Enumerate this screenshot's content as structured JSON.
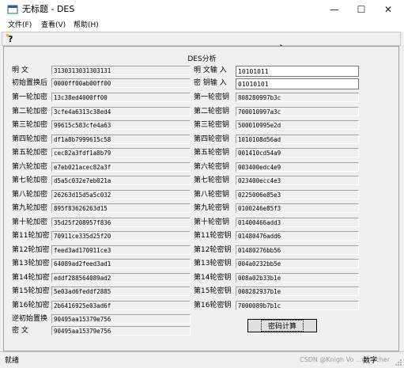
{
  "window": {
    "title": "无标题 - DES"
  },
  "menu": [
    "文件(F)",
    "查看(V)",
    "帮助(H)"
  ],
  "dialog_title": "DES分析",
  "plaintext": {
    "label": "明  文",
    "value": "3130313031303131"
  },
  "initial_perm": {
    "label": "初始置换后",
    "value": "0000ff00ab00ff00"
  },
  "left_rows": [
    {
      "label": "第一轮加密",
      "value": "13c38ed4000ff00"
    },
    {
      "label": "第二轮加密",
      "value": "3cfe4a6313c38ed4"
    },
    {
      "label": "第三轮加密",
      "value": "99615c583cfe4a63"
    },
    {
      "label": "第四轮加密",
      "value": "df1a8b7999615c58"
    },
    {
      "label": "第五轮加密",
      "value": "cec82a3fdf1a8b79"
    },
    {
      "label": "第六轮加密",
      "value": "e7eb021acec82a3f"
    },
    {
      "label": "第七轮加密",
      "value": "d5a5c032e7eb021a"
    },
    {
      "label": "第八轮加密",
      "value": "26263d15d5a5c032"
    },
    {
      "label": "第九轮加密",
      "value": "895f83626263d15"
    },
    {
      "label": "第十轮加密",
      "value": "35d25f208957f836"
    },
    {
      "label": "第11轮加密",
      "value": "70911ce335d25f20"
    },
    {
      "label": "第12轮加密",
      "value": "feed3ad170911ce3"
    },
    {
      "label": "第13轮加密",
      "value": "64089ad2feed3ad1"
    },
    {
      "label": "第14轮加密",
      "value": "eddf288564089ad2"
    },
    {
      "label": "第15轮加密",
      "value": "5e03ad6feddf2885"
    },
    {
      "label": "第16轮加密",
      "value": "2b6416925e03ad6f"
    }
  ],
  "final_perm": {
    "label": "逆初始置换",
    "value": "90495aa15379e756"
  },
  "ciphertext": {
    "label": "密  文",
    "value": "90495aa15379e756"
  },
  "plain_input": {
    "label": "明 文输 入",
    "value": "10101011"
  },
  "key_input": {
    "label": "密 钥输 入",
    "value": "01010101"
  },
  "key_rows": [
    {
      "label": "第一轮密钥",
      "value": "808280997b3c"
    },
    {
      "label": "第二轮密钥",
      "value": "700010997a3c"
    },
    {
      "label": "第三轮密钥",
      "value": "500010995e2d"
    },
    {
      "label": "第四轮密钥",
      "value": "1010108d56ad"
    },
    {
      "label": "第五轮密钥",
      "value": "001410cd54a9"
    },
    {
      "label": "第六轮密钥",
      "value": "003400edc4e9"
    },
    {
      "label": "第七轮密钥",
      "value": "023400ecc4e3"
    },
    {
      "label": "第八轮密钥",
      "value": "0225006e85e3"
    },
    {
      "label": "第九轮密钥",
      "value": "0100246e85f3"
    },
    {
      "label": "第十轮密钥",
      "value": "01400466add3"
    },
    {
      "label": "第11轮密钥",
      "value": "01480476add6"
    },
    {
      "label": "第12轮密钥",
      "value": "01480276bb56"
    },
    {
      "label": "第13轮密钥",
      "value": "004a0232bb5e"
    },
    {
      "label": "第14轮密钥",
      "value": "008a02b33b1e"
    },
    {
      "label": "第15轮密钥",
      "value": "008282937b1e"
    },
    {
      "label": "第16轮密钥",
      "value": "7000089b7b1c"
    }
  ],
  "compute_button": "密码计算",
  "status": {
    "left": "就绪",
    "right": "数字"
  },
  "watermark": "CSDN @Knigh Vo  ...umacher"
}
